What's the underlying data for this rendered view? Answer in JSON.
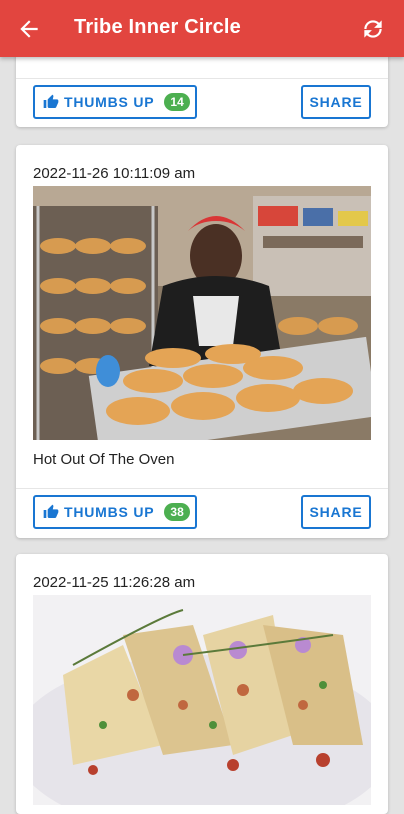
{
  "appbar": {
    "title": "Tribe Inner Circle",
    "back_icon": "arrow-back-icon",
    "refresh_icon": "refresh-icon",
    "color": "#e2453f"
  },
  "posts": [
    {
      "caption": "",
      "thumbs_label": "THUMBS UP",
      "thumbs_count": "14",
      "share_label": "SHARE"
    },
    {
      "timestamp": "2022-11-26 10:11:09 am",
      "caption": "Hot Out Of The Oven",
      "thumbs_label": "THUMBS UP",
      "thumbs_count": "38",
      "share_label": "SHARE"
    },
    {
      "timestamp": "2022-11-25 11:26:28 am"
    }
  ],
  "colors": {
    "accent": "#1976d2",
    "badge": "#4caf50"
  }
}
